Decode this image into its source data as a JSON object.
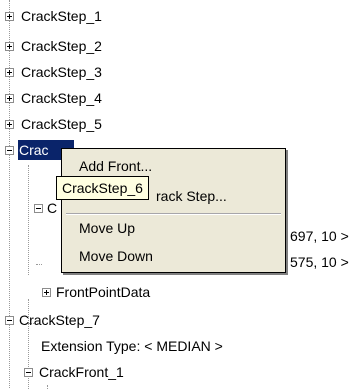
{
  "tree": {
    "items": [
      {
        "label": "CrackStep_1",
        "expanded": false
      },
      {
        "label": "CrackStep_2",
        "expanded": false
      },
      {
        "label": "CrackStep_3",
        "expanded": false
      },
      {
        "label": "CrackStep_4",
        "expanded": false
      },
      {
        "label": "CrackStep_5",
        "expanded": false
      },
      {
        "label": "Crac",
        "expanded": true,
        "selected": true
      },
      {
        "label": "C",
        "expanded": true
      },
      {
        "label": "697, 10 >"
      },
      {
        "label": "575, 10 >"
      },
      {
        "label": "FrontPointData",
        "expanded": false
      },
      {
        "label": "CrackStep_7",
        "expanded": true
      },
      {
        "label": "Extension Type: < MEDIAN >"
      },
      {
        "label": "CrackFront_1",
        "expanded": true
      }
    ]
  },
  "context_menu": {
    "items": [
      {
        "label": "Add Front..."
      },
      {
        "label": "rack Step..."
      },
      {
        "label": "Move Up"
      },
      {
        "label": "Move Down"
      }
    ]
  },
  "tooltip": {
    "text": "CrackStep_6"
  },
  "colors": {
    "selection": "#0a246a",
    "menu_background": "#ece9d8",
    "tooltip_background": "#ffffe1"
  }
}
